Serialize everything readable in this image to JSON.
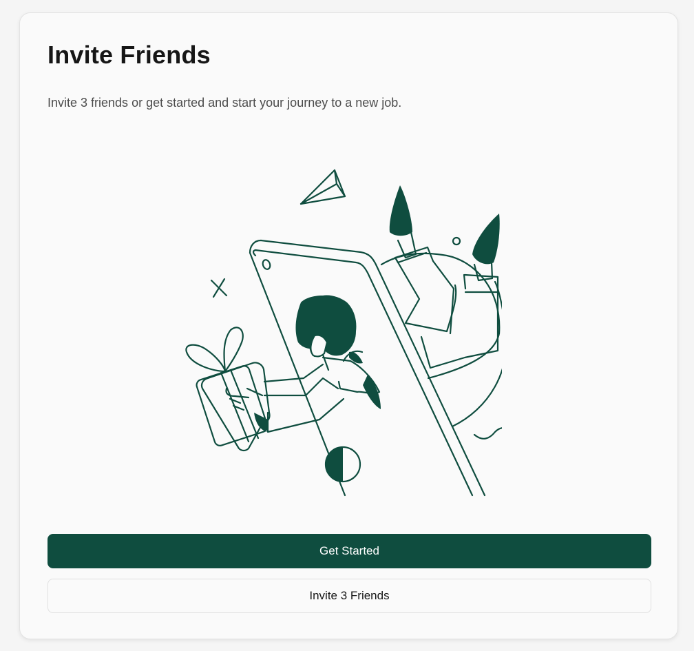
{
  "card": {
    "title": "Invite Friends",
    "description": "Invite 3 friends or get started and start your journey to a new job."
  },
  "illustration": {
    "subject": "person-emerging-from-phone-with-gift",
    "colors": {
      "ink": "#0f4d3f",
      "paper": "#fafafa"
    }
  },
  "actions": {
    "primary_label": "Get Started",
    "secondary_label": "Invite 3 Friends"
  },
  "colors": {
    "accent": "#0f4d3f",
    "text": "#161616",
    "muted_text": "#4b4b4b",
    "card_background": "#fafafa",
    "page_background": "#f5f5f5"
  }
}
